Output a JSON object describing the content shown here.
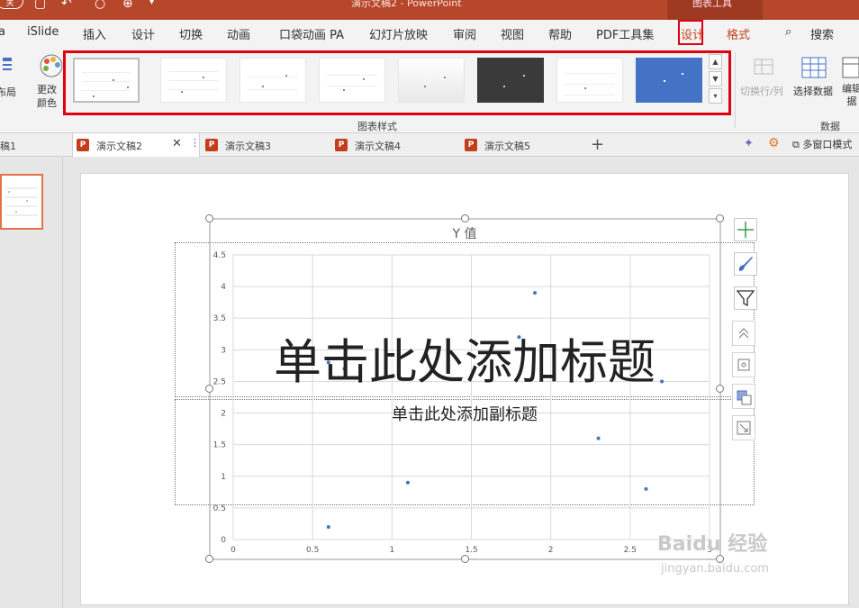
{
  "app": {
    "window_title": "演示文稿2 - PowerPoint",
    "context_tools": "图表工具",
    "autosave_pill": "关"
  },
  "ribbon_tabs": [
    {
      "label": "iSlide"
    },
    {
      "label": "插入"
    },
    {
      "label": "设计"
    },
    {
      "label": "切换"
    },
    {
      "label": "动画"
    },
    {
      "label": "口袋动画 PA"
    },
    {
      "label": "幻灯片放映"
    },
    {
      "label": "审阅"
    },
    {
      "label": "视图"
    },
    {
      "label": "帮助"
    },
    {
      "label": "PDF工具集"
    },
    {
      "label": "设计"
    },
    {
      "label": "格式"
    }
  ],
  "search_label": "搜索",
  "ribbon": {
    "layout_btn": "布局",
    "change_color": "更改\n颜色",
    "chart_styles_label": "图表样式",
    "switch_row_col": "切换行/列",
    "select_data": "选择数据",
    "edit_data": "编辑\n据",
    "data_group_label": "数据"
  },
  "doc_tabs": [
    {
      "label": "稿1"
    },
    {
      "label": "演示文稿2"
    },
    {
      "label": "演示文稿3"
    },
    {
      "label": "演示文稿4"
    },
    {
      "label": "演示文稿5"
    }
  ],
  "multi_window": "多窗口模式",
  "slide": {
    "title_placeholder": "单击此处添加标题",
    "subtitle_placeholder": "单击此处添加副标题"
  },
  "chart_data": {
    "type": "scatter",
    "title": "Y 值",
    "xlim": [
      0,
      3
    ],
    "ylim": [
      0,
      4.5
    ],
    "x_ticks": [
      "0",
      "0.5",
      "1",
      "1.5",
      "2",
      "2.5",
      "3"
    ],
    "y_ticks": [
      "0",
      "0.5",
      "1",
      "1.5",
      "2",
      "2.5",
      "3",
      "3.5",
      "4",
      "4.5"
    ],
    "grid": true,
    "points": [
      {
        "x": 0.6,
        "y": 0.2
      },
      {
        "x": 0.6,
        "y": 2.8
      },
      {
        "x": 0.7,
        "y": 2.7
      },
      {
        "x": 1.1,
        "y": 0.9
      },
      {
        "x": 1.8,
        "y": 3.2
      },
      {
        "x": 1.9,
        "y": 3.9
      },
      {
        "x": 2.3,
        "y": 1.6
      },
      {
        "x": 2.6,
        "y": 0.8
      },
      {
        "x": 2.7,
        "y": 2.5
      }
    ],
    "point_color": "#4472c4"
  },
  "watermark": {
    "text": "Baidu 经验",
    "url_text": "jingyan.baidu.com"
  },
  "colors": {
    "accent": "#b7472a",
    "highlight_box": "#e0000f",
    "series": "#4472c4"
  }
}
